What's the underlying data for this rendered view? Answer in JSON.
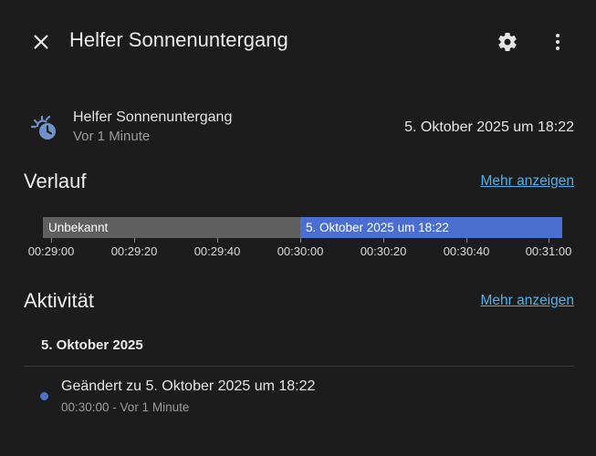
{
  "header": {
    "title": "Helfer Sonnenuntergang",
    "close_icon": "close-icon",
    "settings_icon": "gear-icon",
    "more_icon": "dots-vertical-icon"
  },
  "entity": {
    "icon": "clock-sun-icon",
    "name": "Helfer Sonnenuntergang",
    "last_changed": "Vor 1 Minute",
    "state": "5. Oktober 2025 um 18:22"
  },
  "history": {
    "title": "Verlauf",
    "more_link": "Mehr anzeigen",
    "segments": [
      {
        "label": "Unbekannt",
        "color": "#5f5f5f"
      },
      {
        "label": "5. Oktober 2025 um 18:22",
        "color": "#4a6fd1"
      }
    ],
    "axis_ticks": [
      "00:29:00",
      "00:29:20",
      "00:29:40",
      "00:30:00",
      "00:30:20",
      "00:30:40",
      "00:31:00"
    ]
  },
  "activity": {
    "title": "Aktivität",
    "more_link": "Mehr anzeigen",
    "date_group": "5. Oktober 2025",
    "entries": [
      {
        "message": "Geändert zu 5. Oktober 2025 um 18:22",
        "time": "00:30:00 - Vor 1 Minute"
      }
    ]
  },
  "colors": {
    "background": "#1c1c1c",
    "accent_link": "#4fb0e8",
    "state_blue": "#4a6fd1",
    "state_unknown": "#5f5f5f"
  }
}
